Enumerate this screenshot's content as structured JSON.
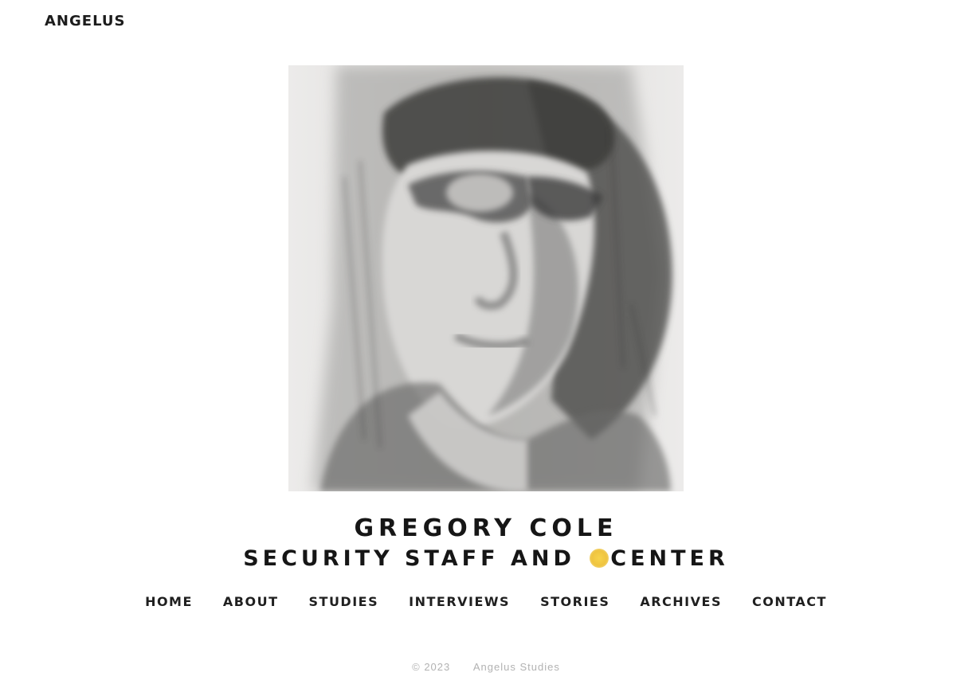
{
  "header": {
    "back_link": "ANGELUS"
  },
  "hero": {
    "image_alt": "Charcoal sketch portrait of a man wearing glasses"
  },
  "titles": {
    "name": "GREGORY COLE",
    "subtitle_before": "SECURITY STAFF AND ",
    "subtitle_after": "CENTER"
  },
  "nav": {
    "items": [
      {
        "label": "HOME"
      },
      {
        "label": "ABOUT"
      },
      {
        "label": "STUDIES"
      },
      {
        "label": "INTERVIEWS"
      },
      {
        "label": "STORIES"
      },
      {
        "label": "ARCHIVES"
      },
      {
        "label": "CONTACT"
      }
    ]
  },
  "footer": {
    "left": "© 2023",
    "right": "Angelus Studies"
  },
  "colors": {
    "accent": "#efc440",
    "text": "#161616",
    "muted": "#b2b2b2"
  }
}
